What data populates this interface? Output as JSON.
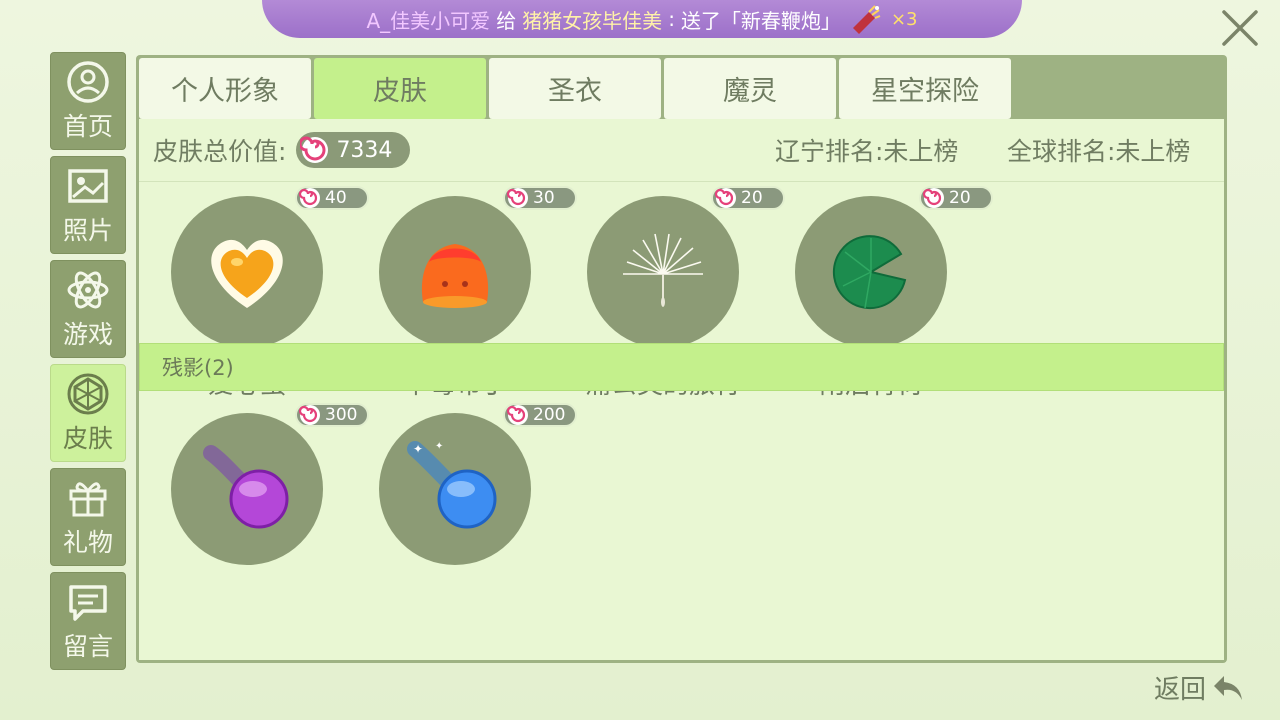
{
  "marquee": {
    "from": "A_佳美小可爱",
    "give_word": "给",
    "to": "猪猪女孩毕佳美",
    "colon": ":",
    "action": "送了「新春鞭炮」",
    "count": "×3",
    "gift_icon": "firework-icon"
  },
  "nav": [
    {
      "label": "首页",
      "icon": "home-icon"
    },
    {
      "label": "照片",
      "icon": "photo-icon"
    },
    {
      "label": "游戏",
      "icon": "atom-icon"
    },
    {
      "label": "皮肤",
      "icon": "skin-icon"
    },
    {
      "label": "礼物",
      "icon": "gift-icon"
    },
    {
      "label": "留言",
      "icon": "message-icon"
    }
  ],
  "tabs": [
    "个人形象",
    "皮肤",
    "圣衣",
    "魔灵",
    "星空探险"
  ],
  "summary": {
    "total_label": "皮肤总价值:",
    "total_value": "7334",
    "local_rank": "辽宁排名:未上榜",
    "global_rank": "全球排名:未上榜"
  },
  "items": [
    {
      "name": "爱心蛋",
      "price": "40",
      "icon": "heart-egg-icon"
    },
    {
      "name": "草莓布丁",
      "price": "30",
      "icon": "pudding-icon"
    },
    {
      "name": "蒲公英的旅行",
      "price": "20",
      "icon": "dandelion-icon"
    },
    {
      "name": "雨后青荷",
      "price": "20",
      "icon": "lotus-leaf-icon"
    }
  ],
  "section": {
    "label": "残影(2)"
  },
  "trail_items": [
    {
      "name": "",
      "price": "300",
      "icon": "purple-trail-icon"
    },
    {
      "name": "",
      "price": "200",
      "icon": "blue-trail-icon"
    }
  ],
  "back_label": "返回",
  "colors": {
    "accent": "#c4f08c",
    "nav": "#8ea06f",
    "marquee": "#a37bcc"
  }
}
